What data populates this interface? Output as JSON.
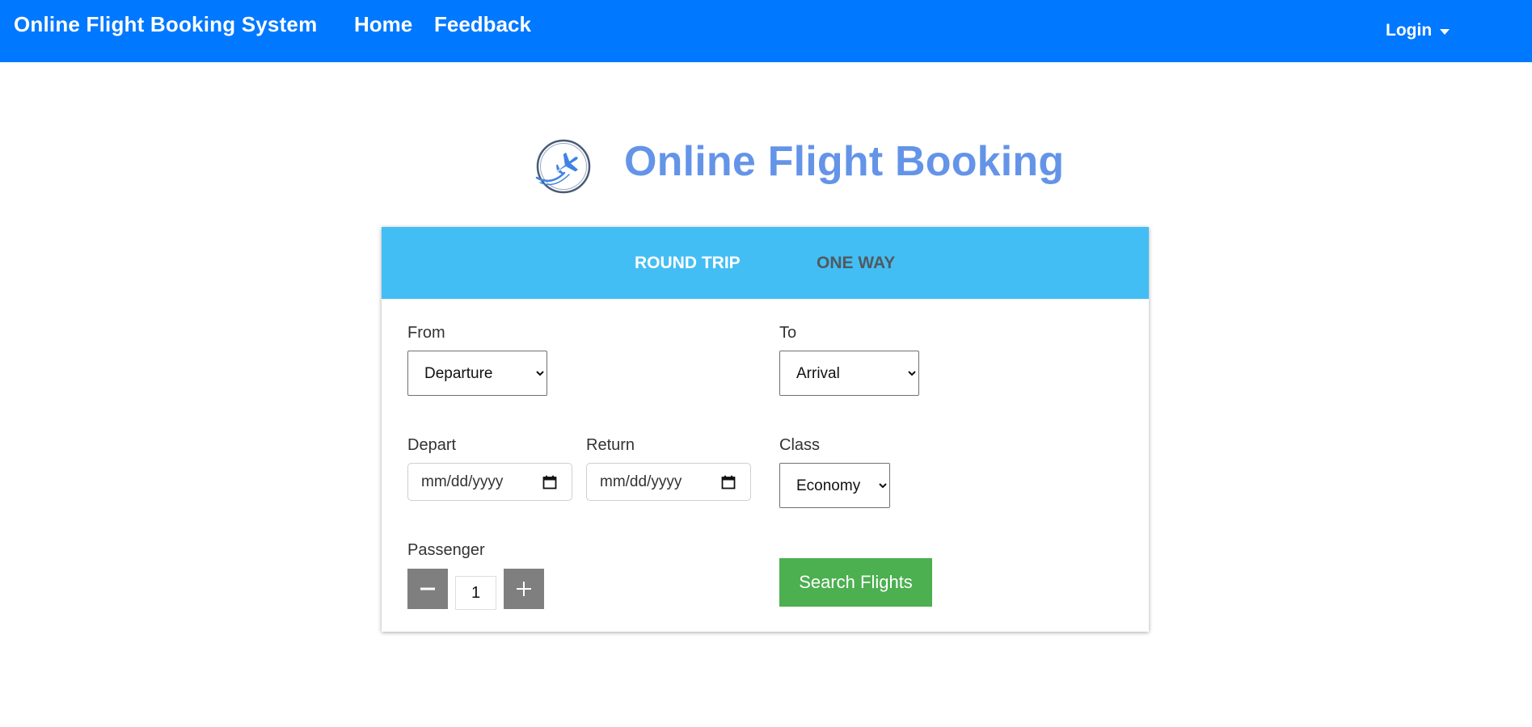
{
  "navbar": {
    "brand": "Online Flight Booking System",
    "links": [
      "Home",
      "Feedback"
    ],
    "login_label": "Login"
  },
  "hero": {
    "title": "Online Flight Booking",
    "logo_icon": "airplane-globe-icon"
  },
  "tabs": {
    "round_trip": "ROUND TRIP",
    "one_way": "ONE WAY"
  },
  "form": {
    "from_label": "From",
    "from_value": "Departure",
    "to_label": "To",
    "to_value": "Arrival",
    "depart_label": "Depart",
    "depart_placeholder": "mm/dd/yyyy",
    "return_label": "Return",
    "return_placeholder": "mm/dd/yyyy",
    "class_label": "Class",
    "class_value": "Economy",
    "passenger_label": "Passenger",
    "passenger_count": "1",
    "search_label": "Search Flights"
  },
  "colors": {
    "navbar": "#0078ff",
    "tabs_bar": "#43bef5",
    "hero_title": "#6494e8",
    "search_button": "#4caf50",
    "stepper": "#7f7f7f"
  }
}
